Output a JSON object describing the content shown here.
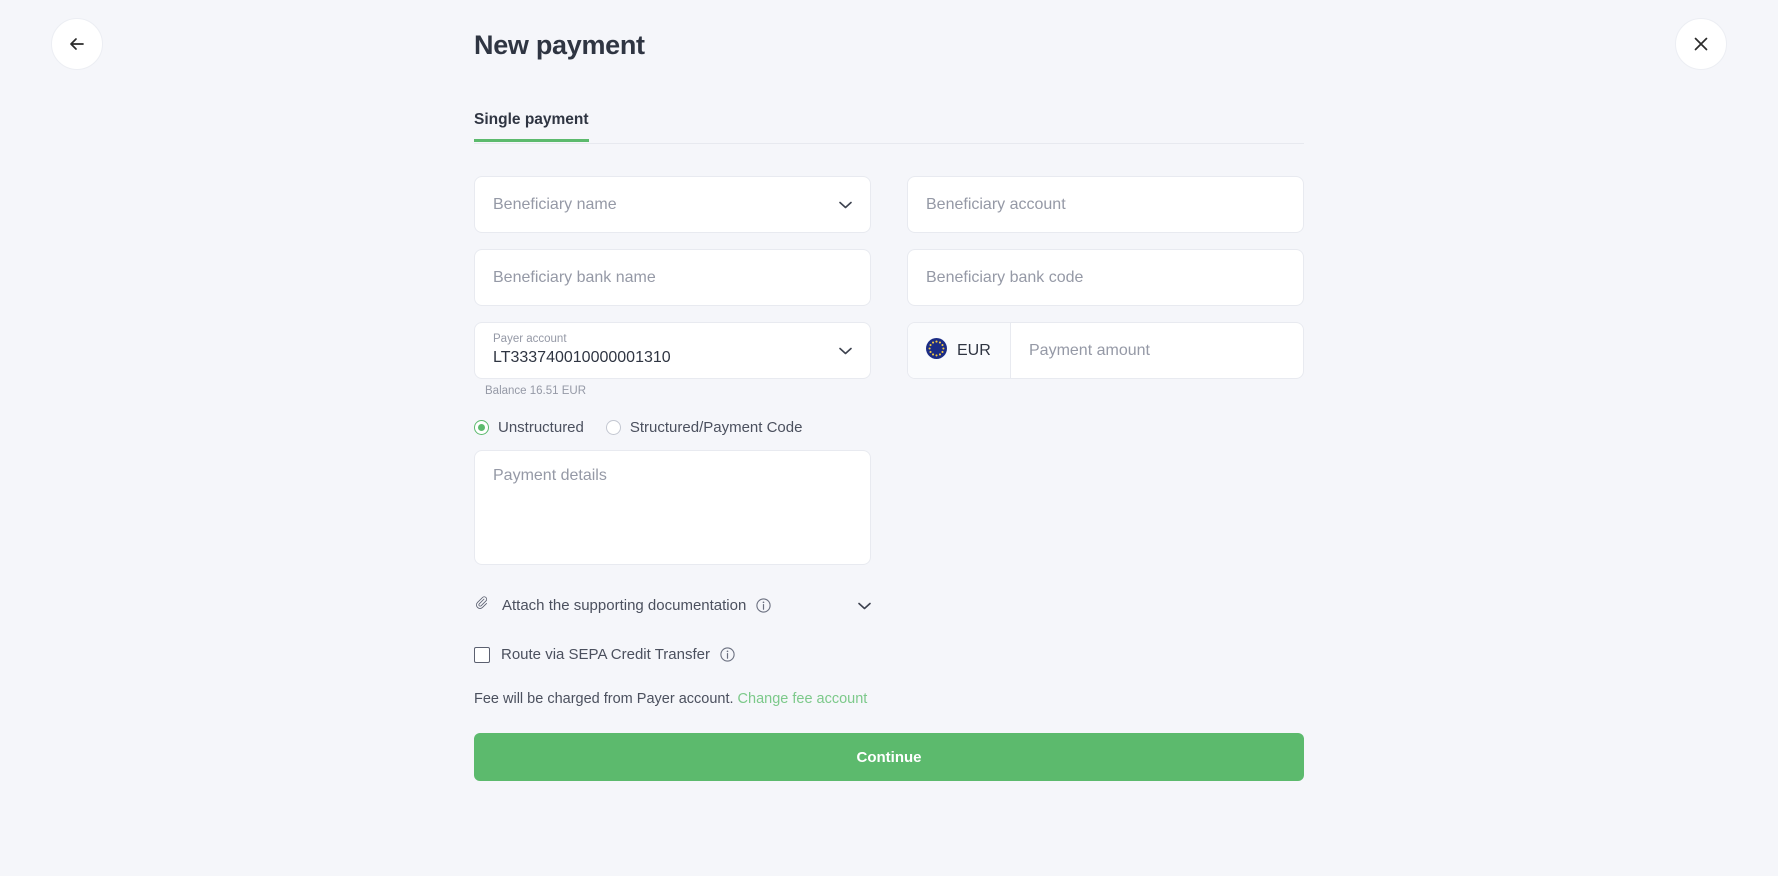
{
  "header": {
    "title": "New payment",
    "back_icon": "arrow-left-icon",
    "close_icon": "close-icon"
  },
  "tabs": [
    {
      "label": "Single payment",
      "active": true
    }
  ],
  "form": {
    "beneficiary_name": {
      "placeholder": "Beneficiary name",
      "value": "",
      "icon": "chevron-down-icon"
    },
    "beneficiary_account": {
      "placeholder": "Beneficiary account",
      "value": ""
    },
    "beneficiary_bank_name": {
      "placeholder": "Beneficiary bank name",
      "value": ""
    },
    "beneficiary_bank_code": {
      "placeholder": "Beneficiary bank code",
      "value": ""
    },
    "payer_account": {
      "label": "Payer account",
      "value": "LT333740010000001310",
      "balance": "Balance 16.51 EUR",
      "icon": "chevron-down-icon"
    },
    "currency": {
      "code": "EUR",
      "icon": "eu-flag-icon"
    },
    "payment_amount": {
      "placeholder": "Payment amount",
      "value": ""
    },
    "details_type": {
      "options": [
        {
          "label": "Unstructured",
          "selected": true
        },
        {
          "label": "Structured/Payment Code",
          "selected": false
        }
      ]
    },
    "payment_details": {
      "placeholder": "Payment details",
      "value": ""
    },
    "attach": {
      "label": "Attach the supporting documentation",
      "clip_icon": "paperclip-icon",
      "info_icon": "info-icon",
      "chevron_icon": "chevron-down-icon"
    },
    "sepa": {
      "label": "Route via SEPA Credit Transfer",
      "checked": false,
      "info_icon": "info-icon"
    },
    "fee": {
      "text": "Fee will be charged from Payer account.",
      "link": "Change fee account"
    },
    "submit": {
      "label": "Continue"
    }
  },
  "colors": {
    "accent": "#5cba6d",
    "link": "#7cc98a",
    "background": "#f5f6fa",
    "text": "#2f3542",
    "placeholder": "#9599a6",
    "flag_blue": "#1b2c85",
    "flag_star": "#f2c945"
  }
}
